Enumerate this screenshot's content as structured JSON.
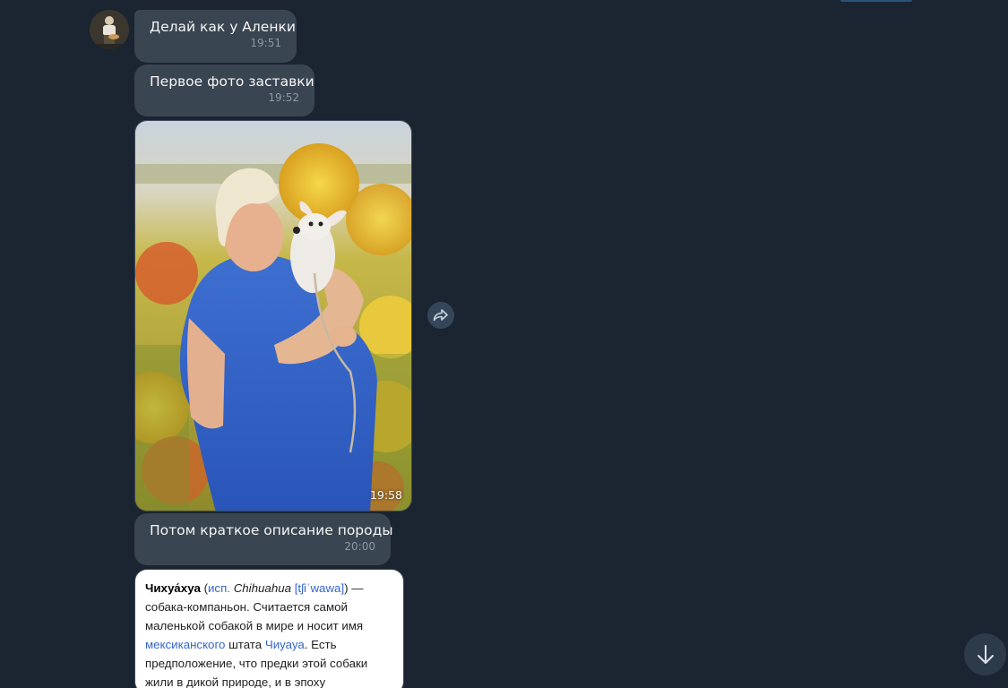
{
  "colors": {
    "background": "#1b2431",
    "bubble": "#3a4552",
    "time_text": "#8d98a5",
    "link": "#3366cc"
  },
  "messages": [
    {
      "text": "Делай как у Аленки",
      "time": "19:51"
    },
    {
      "text": "Первое фото заставки",
      "time": "19:52"
    },
    {
      "type": "photo",
      "time": "19:58"
    },
    {
      "text": "Потом краткое описание породы",
      "time": "20:00"
    }
  ],
  "wiki_card": {
    "term": "Чихуа́хуа",
    "paren_open": " (",
    "lang": "исп.",
    "space": " ",
    "latin": "Chihuahua",
    "ipa": "[tʃiˈwawa]",
    "paren_close": ") —",
    "text1": " собака-компаньон. Считается самой маленькой собакой в мире и носит имя ",
    "link1": "мексиканского",
    "text2": " штата ",
    "link2": "Чиуауа",
    "text3": ". Есть предположение, что предки этой собаки жили в дикой природе, и в эпоху"
  },
  "icons": {
    "share": "share-arrow-icon",
    "scroll_down": "arrow-down-icon",
    "avatar": "user-avatar"
  }
}
